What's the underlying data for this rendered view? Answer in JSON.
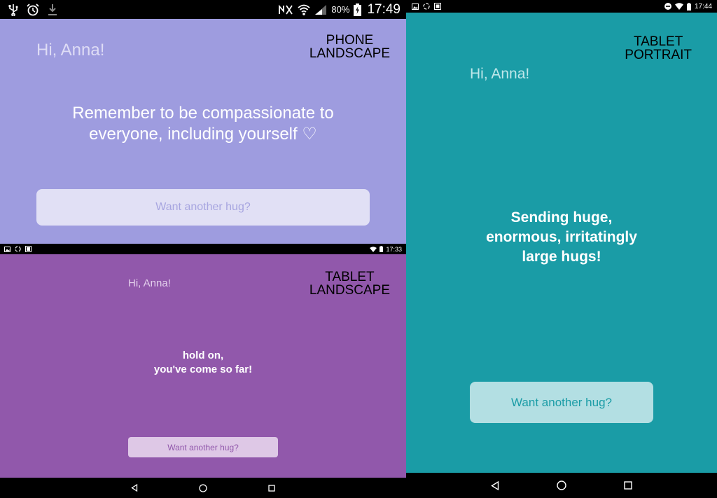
{
  "phone_landscape": {
    "status": {
      "battery": "80%",
      "time": "17:49",
      "left_icons": [
        "usb-icon",
        "alarm-icon",
        "download-icon"
      ],
      "right_icons": [
        "nfc-icon",
        "wifi-icon",
        "signal-icon",
        "battery-charging-icon"
      ]
    },
    "greeting": "Hi, Anna!",
    "tag_line1": "PHONE",
    "tag_line2": "LANDSCAPE",
    "message_line1": "Remember to be compassionate to",
    "message_line2": "everyone, including yourself ♡",
    "button": "Want another hug?",
    "colors": {
      "background": "#9e9cdf",
      "button_bg": "#e1e0f5",
      "button_text": "#a7a5e0"
    }
  },
  "tablet_landscape": {
    "status": {
      "time": "17:33"
    },
    "greeting": "Hi, Anna!",
    "tag_line1": "TABLET",
    "tag_line2": "LANDSCAPE",
    "message_line1": "hold on,",
    "message_line2": "you've come so far!",
    "button": "Want another hug?",
    "colors": {
      "background": "#9158ab",
      "button_bg": "#dec8e6",
      "button_text": "#9158ab"
    }
  },
  "tablet_portrait": {
    "status": {
      "time": "17:44"
    },
    "greeting": "Hi, Anna!",
    "tag_line1": "TABLET",
    "tag_line2": "PORTRAIT",
    "message_line1": "Sending huge,",
    "message_line2": "enormous, irritatingly",
    "message_line3": "large hugs!",
    "button": "Want another hug?",
    "colors": {
      "background": "#1a9ca6",
      "button_bg": "#b3dfe3",
      "button_text": "#1a9ca6"
    }
  },
  "navbar_icons": [
    "back-icon",
    "home-icon",
    "recents-icon"
  ]
}
